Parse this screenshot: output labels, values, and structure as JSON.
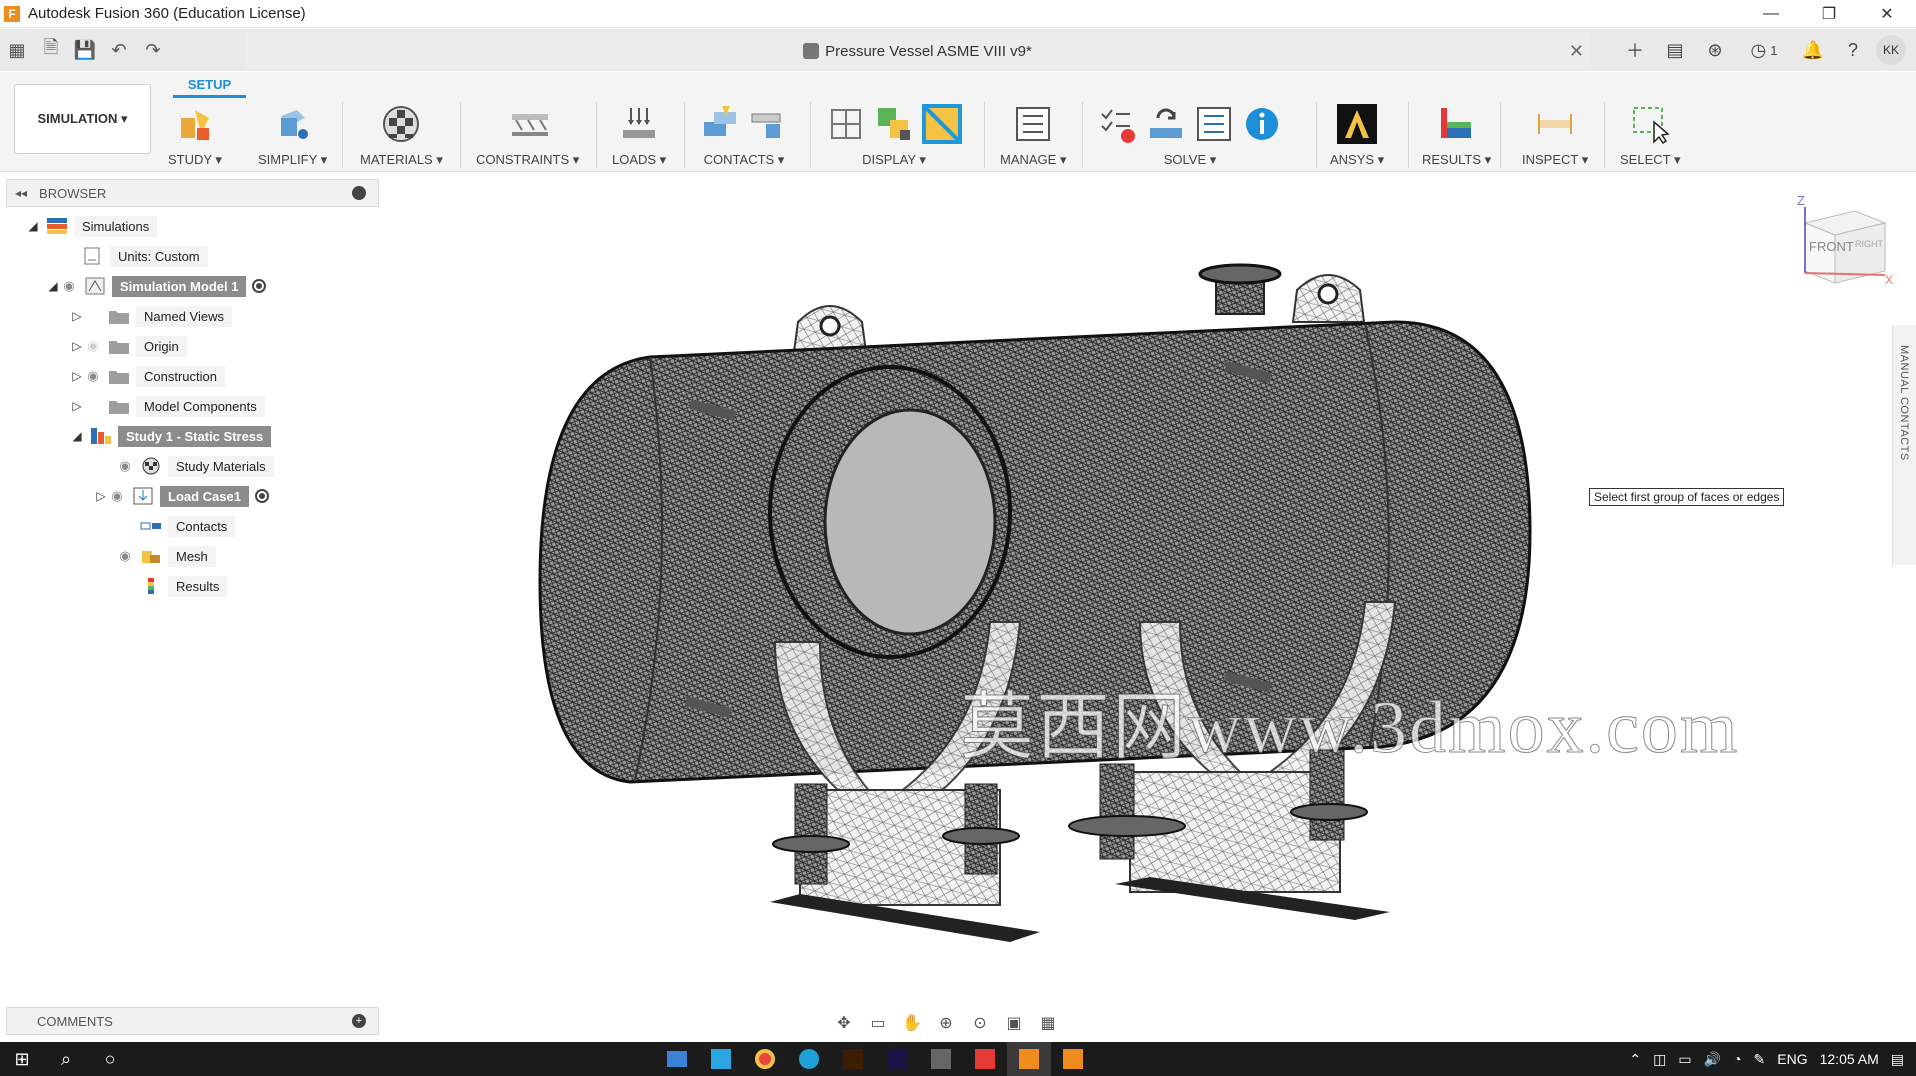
{
  "titlebar": {
    "app_title": "Autodesk Fusion 360 (Education License)"
  },
  "document": {
    "title": "Pressure Vessel ASME VIII v9*"
  },
  "quick_access": {
    "jobs_count": "1",
    "user_initials": "KK"
  },
  "ribbon": {
    "workspace": "SIMULATION ▾",
    "active_tab": "SETUP",
    "groups": {
      "study": "STUDY ▾",
      "simplify": "SIMPLIFY ▾",
      "materials": "MATERIALS ▾",
      "constraints": "CONSTRAINTS ▾",
      "loads": "LOADS ▾",
      "contacts": "CONTACTS ▾",
      "display": "DISPLAY ▾",
      "manage": "MANAGE ▾",
      "solve": "SOLVE ▾",
      "ansys": "ANSYS ▾",
      "results": "RESULTS ▾",
      "inspect": "INSPECT ▾",
      "select": "SELECT ▾"
    }
  },
  "browser": {
    "title": "BROWSER",
    "nodes": [
      {
        "label": "Simulations"
      },
      {
        "label": "Units: Custom"
      },
      {
        "label": "Simulation Model 1"
      },
      {
        "label": "Named Views"
      },
      {
        "label": "Origin"
      },
      {
        "label": "Construction"
      },
      {
        "label": "Model Components"
      },
      {
        "label": "Study 1 - Static Stress"
      },
      {
        "label": "Study Materials"
      },
      {
        "label": "Load Case1"
      },
      {
        "label": "Contacts"
      },
      {
        "label": "Mesh"
      },
      {
        "label": "Results"
      }
    ]
  },
  "viewport": {
    "tooltip": "Select first group of faces or edges",
    "watermark": "莫西网www.3dmox.com",
    "viewcube_front": "FRONT",
    "viewcube_right": "RIGHT",
    "axis_z": "Z",
    "axis_x": "X",
    "side_panel": "MANUAL CONTACTS"
  },
  "comments": {
    "title": "COMMENTS"
  },
  "taskbar": {
    "language": "ENG",
    "time": "12:05 AM"
  },
  "colors": {
    "accent": "#1d8fd8",
    "selection": "#8c8c8c",
    "taskbar": "#1b1b1b"
  }
}
